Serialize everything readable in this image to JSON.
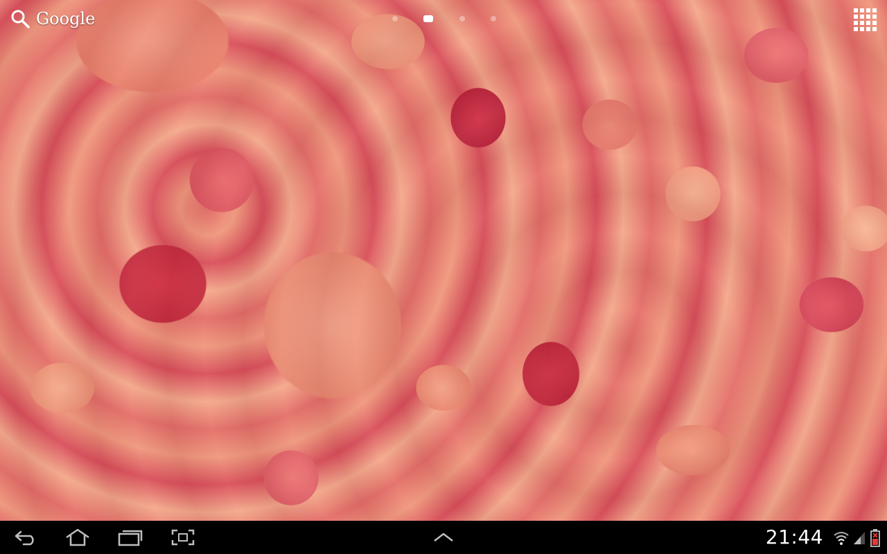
{
  "search_widget": {
    "label": "Google",
    "icon": "search-icon"
  },
  "page_indicator": {
    "page_count": 4,
    "active_page": 2
  },
  "apps_button": {
    "icon": "apps-grid-icon"
  },
  "system_bar": {
    "nav_buttons": [
      {
        "name": "back-button",
        "icon": "back-arrow-icon"
      },
      {
        "name": "home-button",
        "icon": "home-icon"
      },
      {
        "name": "recent-apps-button",
        "icon": "recent-apps-icon"
      },
      {
        "name": "screenshot-button",
        "icon": "screenshot-icon"
      }
    ],
    "center_button": {
      "name": "expand-up-button",
      "icon": "chevron-up-icon"
    },
    "clock": "21:44",
    "status_icons": [
      "wifi-icon",
      "signal-icon",
      "battery-icon"
    ]
  },
  "colors": {
    "bar_background": "#000000",
    "icon_color": "#bfbfbf",
    "battery_warning": "#e53935"
  }
}
